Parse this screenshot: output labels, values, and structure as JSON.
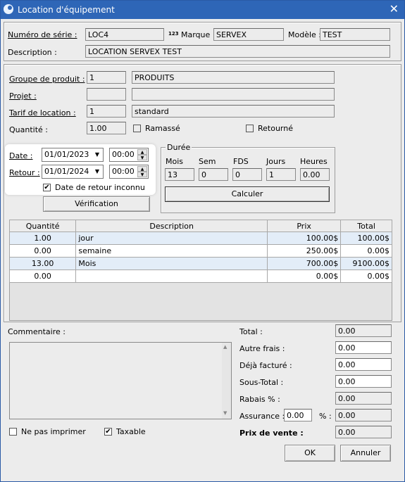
{
  "window": {
    "title": "Location d'équipement",
    "close_glyph": "✕"
  },
  "header": {
    "serial_label": "Numéro de série :",
    "serial_value": "LOC4",
    "brand_badge": "123",
    "brand_label": "Marque :",
    "brand_value": "SERVEX",
    "model_label": "Modèle :",
    "model_value": "TEST",
    "description_label": "Description :",
    "description_value": "LOCATION SERVEX TEST"
  },
  "product": {
    "group_label": "Groupe de produit :",
    "group_code": "1",
    "group_name": "PRODUITS",
    "project_label": "Projet :",
    "project_code": "",
    "project_name": "",
    "rate_label": "Tarif de location :",
    "rate_code": "1",
    "rate_name": "standard",
    "quantity_label": "Quantité :",
    "quantity_value": "1.00",
    "picked_label": "Ramassé",
    "returned_label": "Retourné"
  },
  "dates": {
    "date_label": "Date :",
    "date_value": "01/01/2023",
    "date_time": "00:00",
    "return_label": "Retour :",
    "return_value": "01/01/2024",
    "return_time": "00:00",
    "unknown_return_label": "Date de retour inconnu",
    "unknown_return_checked": "✔",
    "verify_button": "Vérification"
  },
  "duration": {
    "title": "Durée",
    "columns": [
      {
        "label": "Mois",
        "value": "13"
      },
      {
        "label": "Sem",
        "value": "0"
      },
      {
        "label": "FDS",
        "value": "0"
      },
      {
        "label": "Jours",
        "value": "1"
      },
      {
        "label": "Heures",
        "value": "0.00"
      }
    ],
    "calculate_button": "Calculer"
  },
  "grid": {
    "headers": [
      "Quantité",
      "Description",
      "Prix",
      "Total"
    ],
    "rows": [
      {
        "qty": "1.00",
        "desc": "jour",
        "price": "100.00$",
        "total": "100.00$"
      },
      {
        "qty": "0.00",
        "desc": "semaine",
        "price": "250.00$",
        "total": "0.00$"
      },
      {
        "qty": "13.00",
        "desc": "Mois",
        "price": "700.00$",
        "total": "9100.00$"
      },
      {
        "qty": "0.00",
        "desc": "",
        "price": "0.00$",
        "total": "0.00$"
      }
    ]
  },
  "comment": {
    "label": "Commentaire :",
    "value": ""
  },
  "totals": {
    "total_label": "Total :",
    "total_value": "0.00",
    "other_fees_label": "Autre frais :",
    "other_fees_value": "0.00",
    "billed_label": "Déjà facturé :",
    "billed_value": "0.00",
    "subtotal_label": "Sous-Total :",
    "subtotal_value": "0.00",
    "discount_label": "Rabais % :",
    "discount_value": "0.00",
    "insurance_label": "Assurance :",
    "insurance_pct": "0.00",
    "insurance_pct_sign": "% :",
    "insurance_value": "0.00",
    "sale_price_label": "Prix de vente :",
    "sale_price_value": "0.00"
  },
  "footer": {
    "no_print_label": "Ne pas imprimer",
    "taxable_label": "Taxable",
    "taxable_checked": "✔",
    "ok_button": "OK",
    "cancel_button": "Annuler"
  }
}
